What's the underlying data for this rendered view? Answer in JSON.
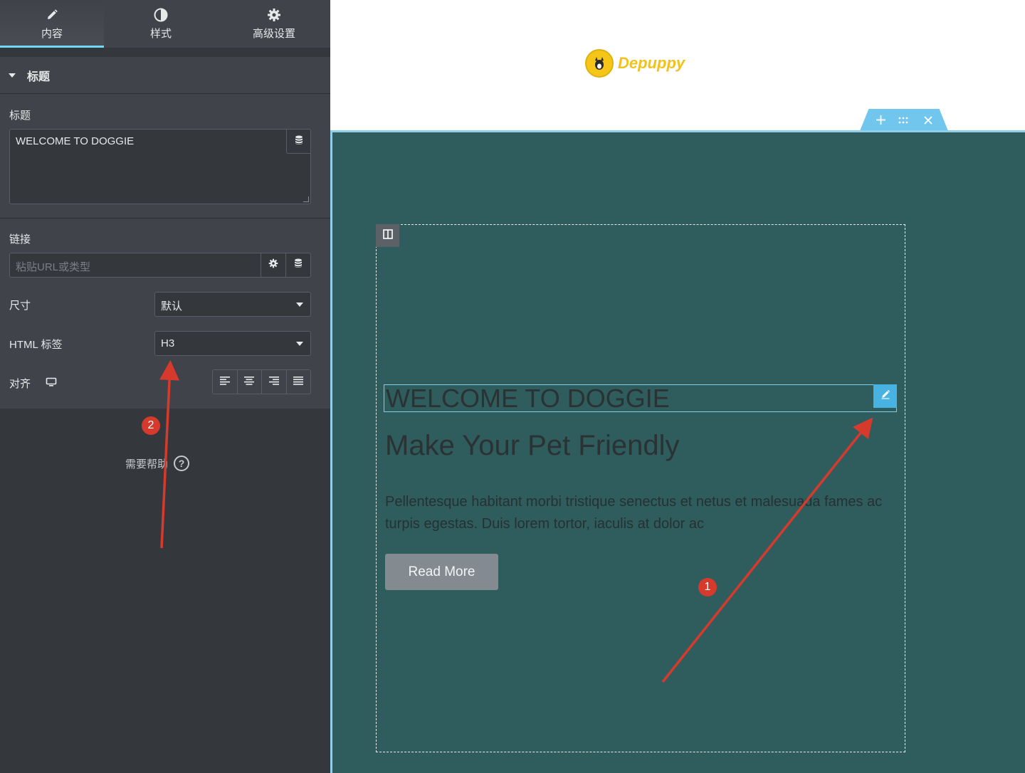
{
  "tabs": [
    {
      "label": "内容",
      "icon": "pencil-icon"
    },
    {
      "label": "样式",
      "icon": "contrast-icon"
    },
    {
      "label": "高级设置",
      "icon": "gear-icon"
    }
  ],
  "section": {
    "title": "标题"
  },
  "fields": {
    "title_label": "标题",
    "title_value": "WELCOME TO DOGGIE",
    "link_label": "链接",
    "link_placeholder": "粘贴URL或类型",
    "size_label": "尺寸",
    "size_value": "默认",
    "html_tag_label": "HTML 标签",
    "html_tag_value": "H3",
    "align_label": "对齐"
  },
  "help": {
    "label": "需要帮助"
  },
  "preview": {
    "logo_text": "Depuppy",
    "heading_welcome": "WELCOME TO DOGGIE",
    "heading_main": "Make Your Pet Friendly",
    "paragraph": "Pellentesque habitant morbi tristique senectus et netus et malesuada fames ac turpis egestas. Duis lorem tortor, iaculis at dolor ac",
    "button_label": "Read More"
  },
  "annotations": {
    "marker_1": "1",
    "marker_2": "2"
  },
  "colors": {
    "panel_bg": "#404349",
    "panel_dark": "#34373c",
    "accent": "#71d7f7",
    "section_bg": "#2f5c5d",
    "arrow": "#d63a2c",
    "edit_button": "#48b3e2",
    "logo": "#f2c21a"
  }
}
